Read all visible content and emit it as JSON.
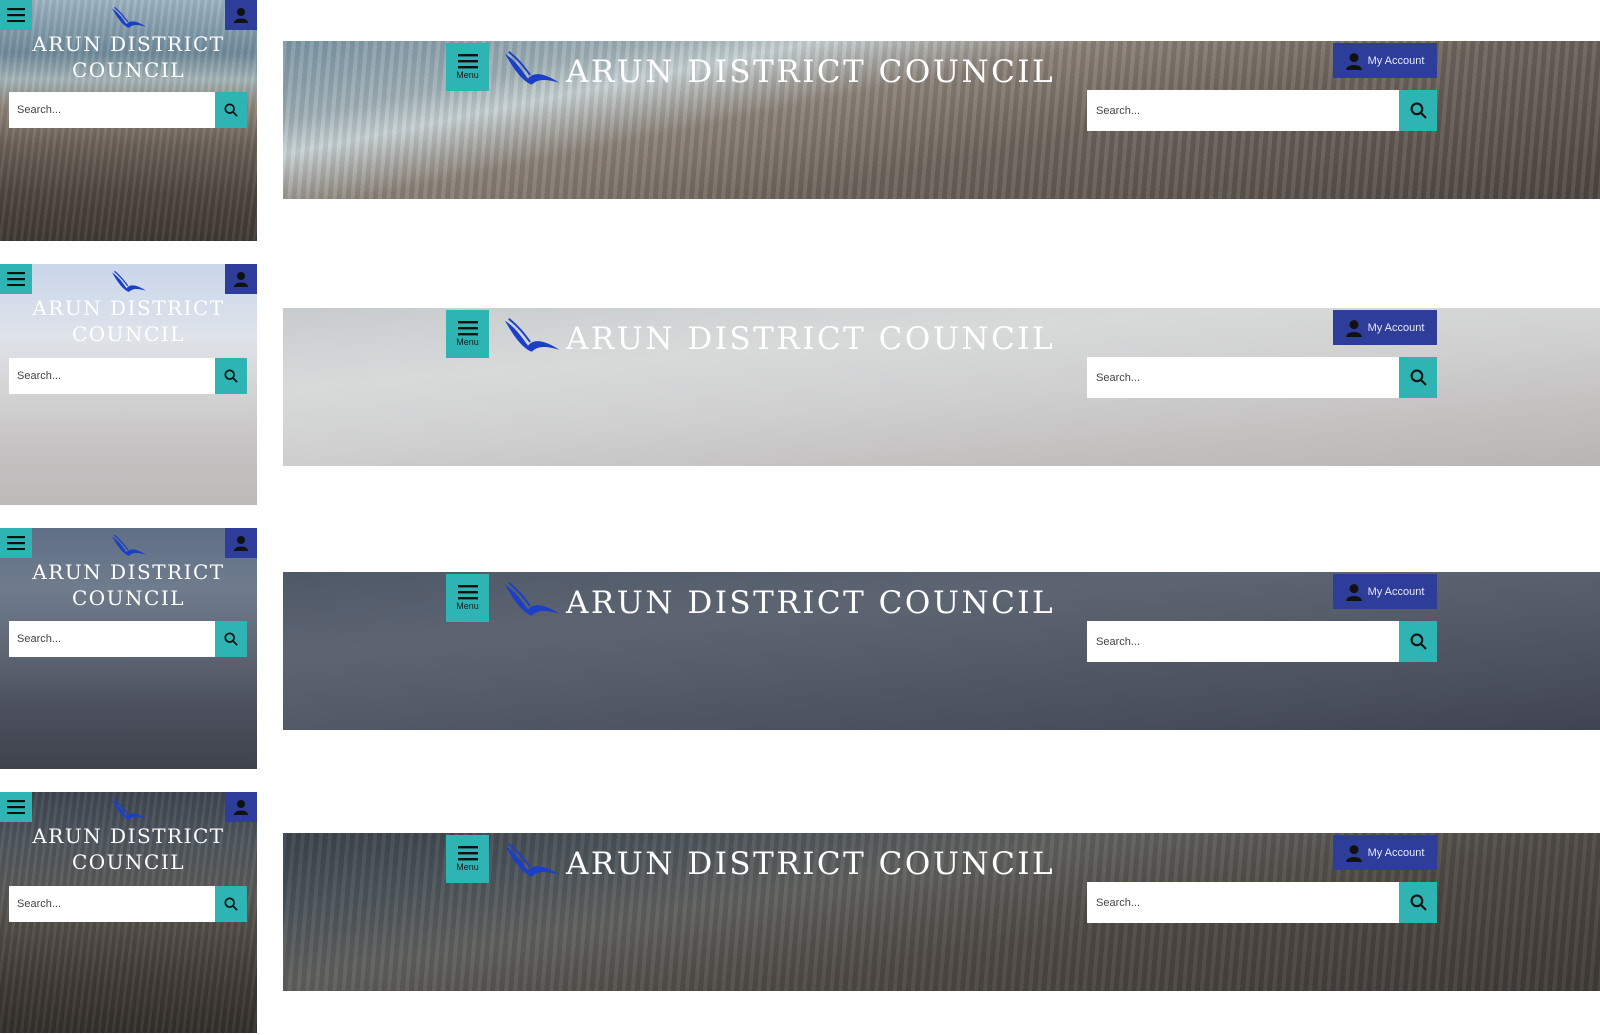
{
  "brand": {
    "title": "ARUN DISTRICT COUNCIL",
    "title_line1": "ARUN DISTRICT",
    "title_line2": "COUNCIL",
    "logo_icon": "seagull-logo",
    "logo_color": "#1b3fc9"
  },
  "menu": {
    "label": "Menu",
    "icon": "hamburger-icon"
  },
  "account": {
    "label": "My Account",
    "icon": "user-silhouette-icon"
  },
  "search": {
    "placeholder": "Search...",
    "icon": "magnifier-icon"
  },
  "colors": {
    "teal": "#2fb4b4",
    "navy": "#2e3d99",
    "text": "#ffffff"
  },
  "variants": [
    {
      "name": "beach-photo"
    },
    {
      "name": "light-grey-overlay"
    },
    {
      "name": "dark-blue-overlay"
    },
    {
      "name": "dark-beach-photo"
    }
  ]
}
